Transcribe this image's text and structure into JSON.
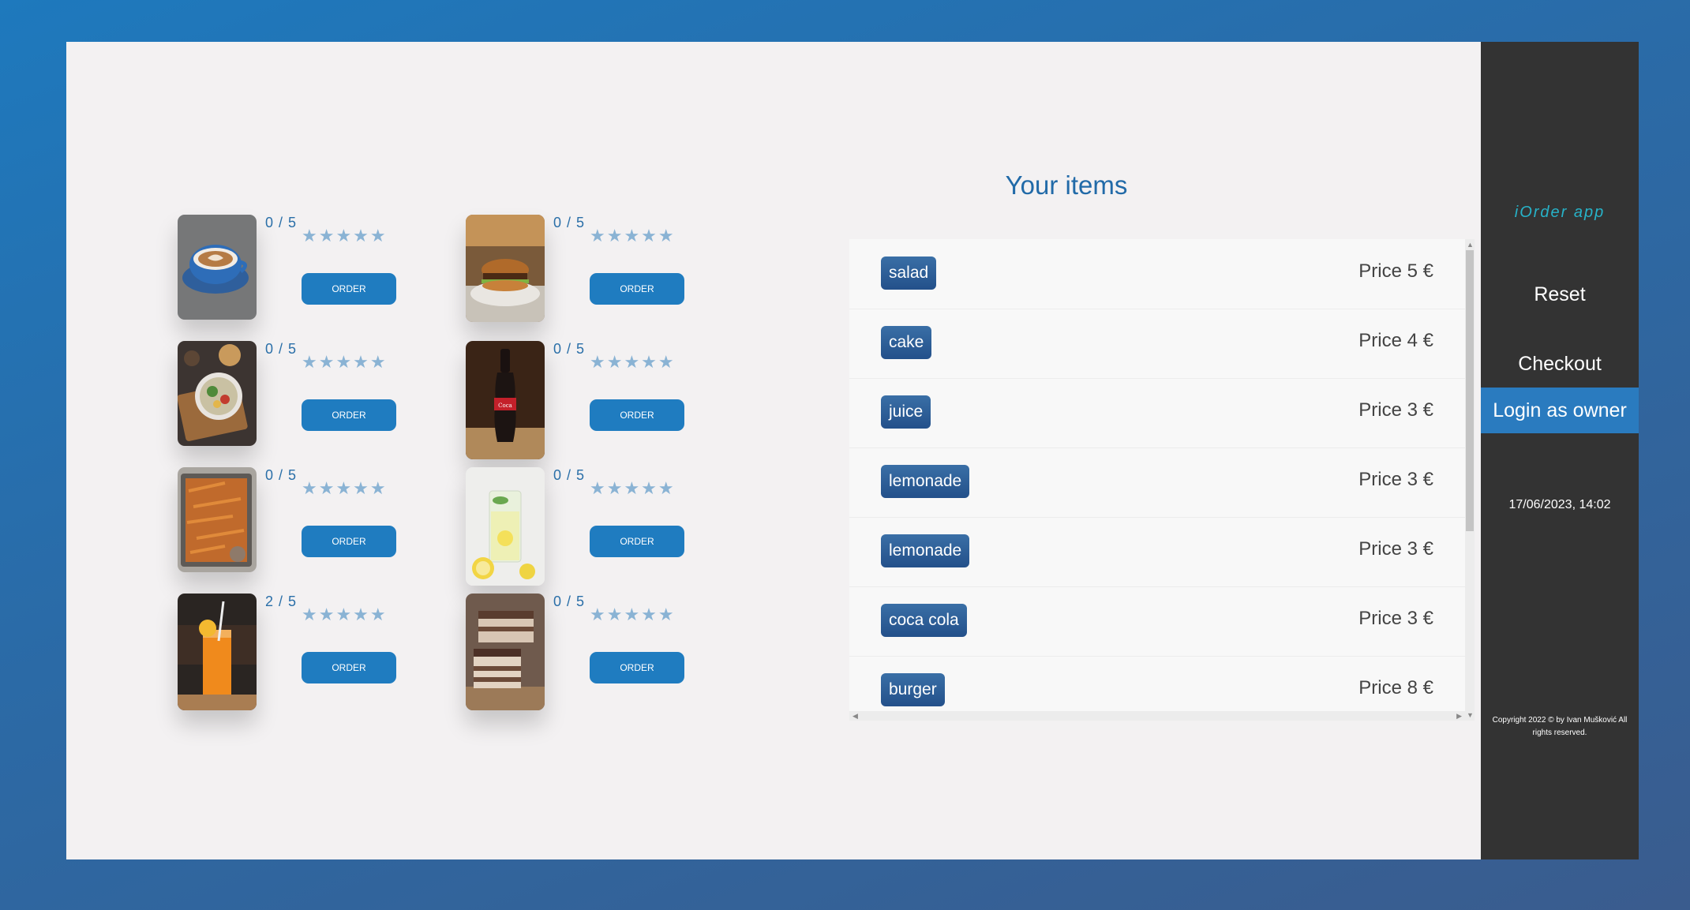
{
  "sidebar": {
    "app_title": "iOrder app",
    "reset_label": "Reset",
    "checkout_label": "Checkout",
    "login_label": "Login as owner",
    "datetime": "17/06/2023, 14:02",
    "copyright": "Copyright 2022 © by Ivan Mušković All rights reserved."
  },
  "menu": {
    "order_label": "ORDER",
    "stars": "★★★★★",
    "items": [
      {
        "rating": "0 / 5",
        "image": "coffee-cup"
      },
      {
        "rating": "0 / 5",
        "image": "burger"
      },
      {
        "rating": "0 / 5",
        "image": "salad-bowl"
      },
      {
        "rating": "0 / 5",
        "image": "coca-cola-bottle"
      },
      {
        "rating": "0 / 5",
        "image": "fries"
      },
      {
        "rating": "0 / 5",
        "image": "lemonade"
      },
      {
        "rating": "2 / 5",
        "image": "orange-juice"
      },
      {
        "rating": "0 / 5",
        "image": "cake"
      }
    ]
  },
  "cart": {
    "title": "Your items",
    "items": [
      {
        "name": "salad",
        "price": "Price 5 €"
      },
      {
        "name": "cake",
        "price": "Price 4 €"
      },
      {
        "name": "juice",
        "price": "Price 3 €"
      },
      {
        "name": "lemonade",
        "price": "Price 3 €"
      },
      {
        "name": "lemonade",
        "price": "Price 3 €"
      },
      {
        "name": "coca cola",
        "price": "Price 3 €"
      },
      {
        "name": "burger",
        "price": "Price 8 €"
      }
    ]
  },
  "colors": {
    "accent": "#1f7cc0",
    "sidebar_bg": "#333333",
    "app_title": "#27b2c8",
    "chip": "#2c5f98"
  }
}
